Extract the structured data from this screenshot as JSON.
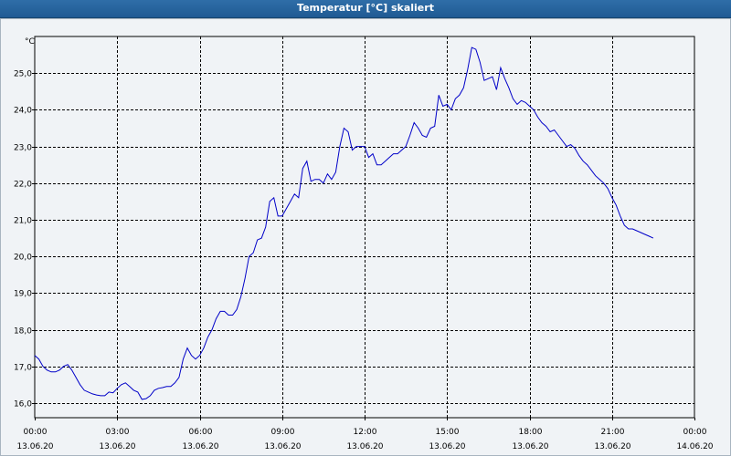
{
  "window": {
    "title": "Temperatur [°C] skaliert"
  },
  "chart_data": {
    "type": "line",
    "title": "Temperatur [°C] skaliert",
    "ylabel": "°C",
    "xlabel": "",
    "ylim": [
      15.6,
      26.0
    ],
    "xlim": [
      0,
      24
    ],
    "grid": true,
    "line_color": "#0000c8",
    "grid_color": "#000000",
    "y_ticks": [
      "16,0",
      "17,0",
      "18,0",
      "19,0",
      "20,0",
      "21,0",
      "22,0",
      "23,0",
      "24,0",
      "25,0"
    ],
    "y_tick_values": [
      16,
      17,
      18,
      19,
      20,
      21,
      22,
      23,
      24,
      25
    ],
    "x_ticks": [
      {
        "time": "00:00",
        "date": "13.06.20"
      },
      {
        "time": "03:00",
        "date": "13.06.20"
      },
      {
        "time": "06:00",
        "date": "13.06.20"
      },
      {
        "time": "09:00",
        "date": "13.06.20"
      },
      {
        "time": "12:00",
        "date": "13.06.20"
      },
      {
        "time": "15:00",
        "date": "13.06.20"
      },
      {
        "time": "18:00",
        "date": "13.06.20"
      },
      {
        "time": "21:00",
        "date": "13.06.20"
      },
      {
        "time": "00:00",
        "date": "14.06.20"
      }
    ],
    "x": [
      0,
      0.15,
      0.3,
      0.45,
      0.6,
      0.75,
      0.9,
      1.05,
      1.2,
      1.35,
      1.5,
      1.65,
      1.8,
      1.95,
      2.1,
      2.25,
      2.4,
      2.55,
      2.7,
      2.85,
      3.0,
      3.15,
      3.3,
      3.45,
      3.6,
      3.75,
      3.9,
      4.05,
      4.2,
      4.35,
      4.5,
      4.65,
      4.8,
      4.95,
      5.1,
      5.25,
      5.4,
      5.55,
      5.7,
      5.85,
      6.0,
      6.15,
      6.3,
      6.45,
      6.6,
      6.75,
      6.9,
      7.05,
      7.2,
      7.35,
      7.5,
      7.65,
      7.8,
      7.95,
      8.1,
      8.25,
      8.4,
      8.55,
      8.7,
      8.85,
      9.0,
      9.15,
      9.3,
      9.45,
      9.6,
      9.75,
      9.9,
      10.05,
      10.2,
      10.35,
      10.5,
      10.65,
      10.8,
      10.95,
      11.1,
      11.25,
      11.4,
      11.55,
      11.7,
      11.85,
      12.0,
      12.15,
      12.3,
      12.45,
      12.6,
      12.75,
      12.9,
      13.05,
      13.2,
      13.35,
      13.5,
      13.65,
      13.8,
      13.95,
      14.1,
      14.25,
      14.4,
      14.55,
      14.7,
      14.85,
      15.0,
      15.15,
      15.3,
      15.45,
      15.6,
      15.75,
      15.9,
      16.05,
      16.2,
      16.35,
      16.5,
      16.65,
      16.8,
      16.95,
      17.1,
      17.25,
      17.4,
      17.55,
      17.7,
      17.85,
      18.0,
      18.15,
      18.3,
      18.45,
      18.6,
      18.75,
      18.9,
      19.05,
      19.2,
      19.35,
      19.5,
      19.65,
      19.8,
      19.95,
      20.1,
      20.25,
      20.4,
      20.55,
      20.7,
      20.85,
      21.0,
      21.15,
      21.3,
      21.45,
      21.6,
      21.75,
      21.9,
      22.05,
      22.2,
      22.35,
      22.5,
      22.65,
      22.8,
      22.95,
      23.1,
      23.25,
      23.4,
      23.55,
      23.7,
      23.85,
      24.0
    ],
    "series": [
      {
        "values": [
          17.3,
          17.2,
          17.0,
          16.9,
          16.85,
          16.85,
          16.9,
          17.0,
          17.05,
          16.9,
          16.7,
          16.5,
          16.35,
          16.3,
          16.25,
          16.22,
          16.2,
          16.2,
          16.3,
          16.28,
          16.4,
          16.5,
          16.55,
          16.45,
          16.35,
          16.3,
          16.1,
          16.12,
          16.2,
          16.35,
          16.4,
          16.42,
          16.45,
          16.45,
          16.55,
          16.7,
          17.2,
          17.5,
          17.3,
          17.2,
          17.3,
          17.5,
          17.8,
          18.0,
          18.3,
          18.5,
          18.5,
          18.4,
          18.4,
          18.55,
          18.9,
          19.4,
          20.0,
          20.1,
          20.45,
          20.5,
          20.8,
          21.5,
          21.6,
          21.1,
          21.1,
          21.3,
          21.5,
          21.7,
          21.6,
          22.4,
          22.6,
          22.05,
          22.1,
          22.1,
          22.0,
          22.25,
          22.1,
          22.3,
          23.0,
          23.5,
          23.4,
          22.9,
          23.0,
          23.0,
          23.0,
          22.7,
          22.8,
          22.5,
          22.5,
          22.6,
          22.7,
          22.8,
          22.8,
          22.9,
          23.0,
          23.3,
          23.65,
          23.5,
          23.3,
          23.25,
          23.5,
          23.55,
          24.4,
          24.1,
          24.15,
          24.0,
          24.3,
          24.4,
          24.6,
          25.1,
          25.7,
          25.65,
          25.3,
          24.8,
          24.85,
          24.9,
          24.55,
          25.15,
          24.85,
          24.6,
          24.3,
          24.15,
          24.25,
          24.2,
          24.1,
          24.0,
          23.8,
          23.65,
          23.55,
          23.4,
          23.45,
          23.3,
          23.15,
          23.0,
          23.05,
          22.95,
          22.75,
          22.6,
          22.5,
          22.35,
          22.2,
          22.1,
          22.0,
          21.85,
          21.6,
          21.4,
          21.1,
          20.85,
          20.75,
          20.75,
          20.7,
          20.65,
          20.6,
          20.55,
          20.5
        ]
      }
    ]
  }
}
